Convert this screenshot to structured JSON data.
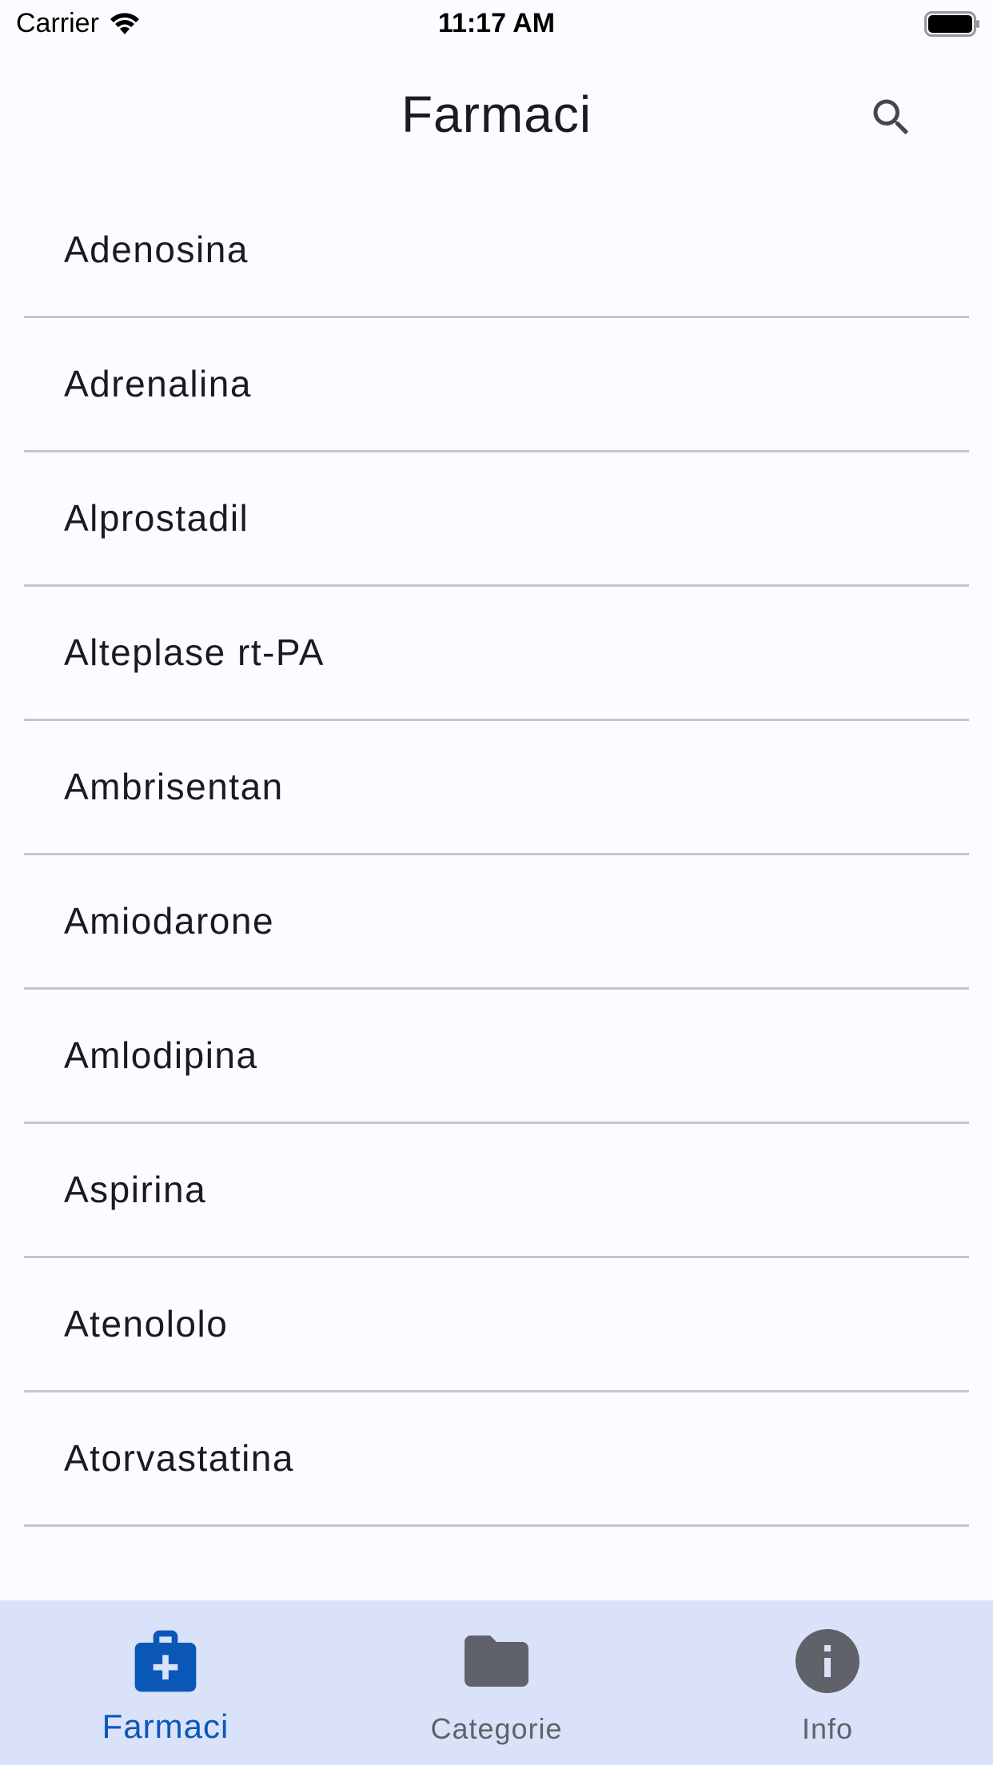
{
  "status_bar": {
    "carrier": "Carrier",
    "time": "11:17 AM"
  },
  "app_bar": {
    "title": "Farmaci",
    "search_icon": "search-icon"
  },
  "drugs": [
    "Adenosina",
    "Adrenalina",
    "Alprostadil",
    "Alteplase rt-PA",
    "Ambrisentan",
    "Amiodarone",
    "Amlodipina",
    "Aspirina",
    "Atenololo",
    "Atorvastatina"
  ],
  "bottom_nav": {
    "items": [
      {
        "label": "Farmaci",
        "icon": "medical-kit-icon",
        "active": true
      },
      {
        "label": "Categorie",
        "icon": "folder-icon",
        "active": false
      },
      {
        "label": "Info",
        "icon": "info-icon",
        "active": false
      }
    ]
  },
  "colors": {
    "accent": "#0b57b8",
    "nav_background": "#dae2f9",
    "inactive_icon": "#5f6268",
    "divider": "#c4c6cf",
    "background": "#fdfbff"
  }
}
